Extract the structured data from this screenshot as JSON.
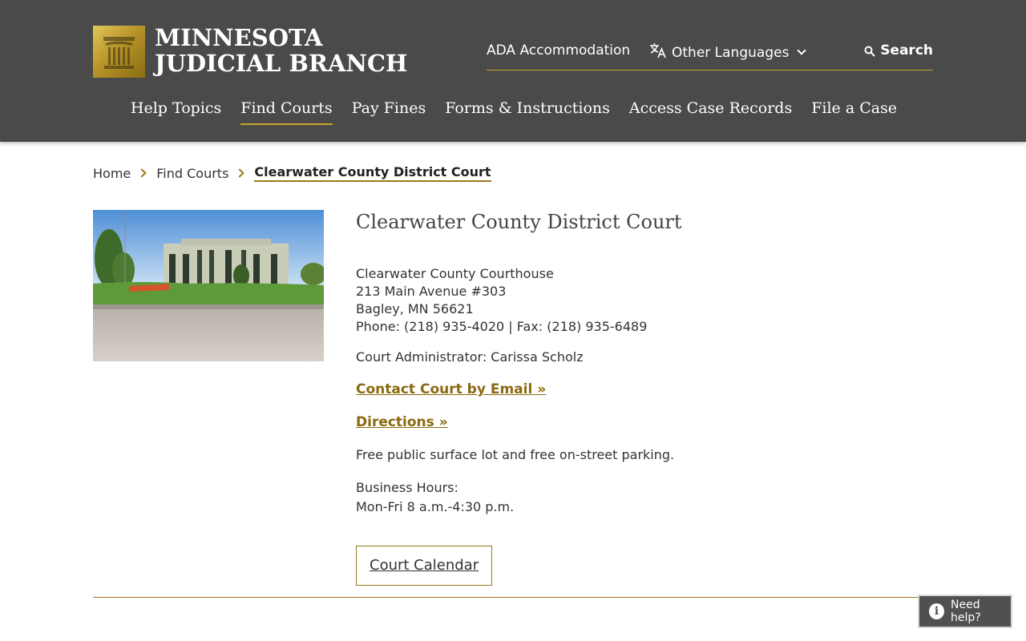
{
  "header": {
    "brand_line1": "MINNESOTA",
    "brand_line2": "JUDICIAL BRANCH",
    "logo_icon": "pillar-logo-icon",
    "utility": {
      "ada": "ADA Accommodation",
      "languages": "Other Languages",
      "search": "Search"
    },
    "nav": [
      {
        "label": "Help Topics",
        "active": false
      },
      {
        "label": "Find Courts",
        "active": true
      },
      {
        "label": "Pay Fines",
        "active": false
      },
      {
        "label": "Forms & Instructions",
        "active": false
      },
      {
        "label": "Access Case Records",
        "active": false
      },
      {
        "label": "File a Case",
        "active": false
      }
    ]
  },
  "breadcrumb": {
    "home": "Home",
    "parent": "Find Courts",
    "current": "Clearwater County District Court"
  },
  "court": {
    "title": "Clearwater County District Court",
    "building": "Clearwater County Courthouse",
    "street": "213 Main Avenue #303",
    "city": "Bagley, MN 56621",
    "phone_fax": "Phone: (218) 935-4020 | Fax: (218) 935-6489",
    "administrator": "Court Administrator: Carissa Scholz",
    "email_link": "Contact Court by Email",
    "directions_link": "Directions",
    "link_suffix": "»",
    "parking": "Free public surface lot and free on-street parking.",
    "hours_label": "Business Hours:",
    "hours": "Mon-Fri 8 a.m.-4:30 p.m.",
    "calendar_button": "Court Calendar"
  },
  "help_widget": {
    "label": "Need help?"
  },
  "colors": {
    "header_bg": "#4a4a4a",
    "accent_gold": "#9a7a1a",
    "link_gold": "#8a6a10"
  }
}
